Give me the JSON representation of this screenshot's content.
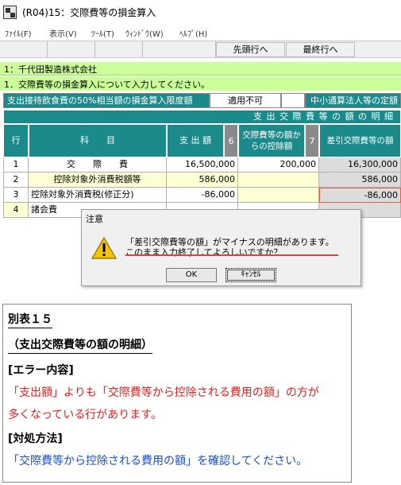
{
  "window": {
    "title": "(R04)15：交際費等の損金算入"
  },
  "menu": [
    "ﾌｧｲﾙ(F)",
    "表示(V)",
    "ﾂｰﾙ(T)",
    "ｳｨﾝﾄﾞｳ(W)",
    "ﾍﾙﾌﾟ(H)"
  ],
  "toolbar": {
    "first_row": "先頭行へ",
    "last_row": "最終行へ"
  },
  "company": "1：千代田製造株式会社",
  "section": "1．交際費等の損金算入について入力してください。",
  "limit": {
    "label": "支出接待飲食費の50%相当額の損金算入限度額",
    "value": "適用不可",
    "right_label": "中小通算法人等の定額"
  },
  "grid": {
    "group_header": "支 出 交 際 費 等 の 額 の 明 細",
    "col_row": "行",
    "col_subject": "科　　目",
    "col_amount": "支 出 額",
    "col_amount_num": "6",
    "col_deduct": "交際費等の額からの控除額",
    "col_deduct_num": "7",
    "col_diff": "差引交際費等の額",
    "rows": [
      {
        "no": "1",
        "subject": "交　　際　　費",
        "amount": "16,500,000",
        "deduct": "200,000",
        "diff": "16,300,000"
      },
      {
        "no": "2",
        "subject": "控除対象外消費税額等",
        "amount": "586,000",
        "deduct": "",
        "diff": "586,000"
      },
      {
        "no": "3",
        "subject": "控除対象外消費税(修正分)",
        "amount": "-86,000",
        "deduct": "",
        "diff": "-86,000"
      },
      {
        "no": "4",
        "subject": "諸会費",
        "amount": "",
        "deduct": "",
        "diff": ""
      }
    ]
  },
  "dialog": {
    "title": "注意",
    "message_line1": "「差引交際費等の額」がマイナスの明細があります。",
    "message_line2": "このまま入力終了してよろしいですか？",
    "ok": "OK",
    "cancel": "ｷｬﾝｾﾙ"
  },
  "note": {
    "heading": "別表１５",
    "subheading": "（支出交際費等の額の明細）",
    "error_label": "[エラー内容]",
    "error_line1": "「支出額」よりも「交際費等から控除される費用の額」の方が",
    "error_line2": "多くなっている行があります。",
    "fix_label": "[対処方法]",
    "fix_line": "「交際費等から控除される費用の額」を確認してください。"
  },
  "colors": {
    "header_teal": "#1b8a8a",
    "green_row": "#ccff99",
    "error_red": "#e02020",
    "fix_blue": "#1a4fd0"
  }
}
